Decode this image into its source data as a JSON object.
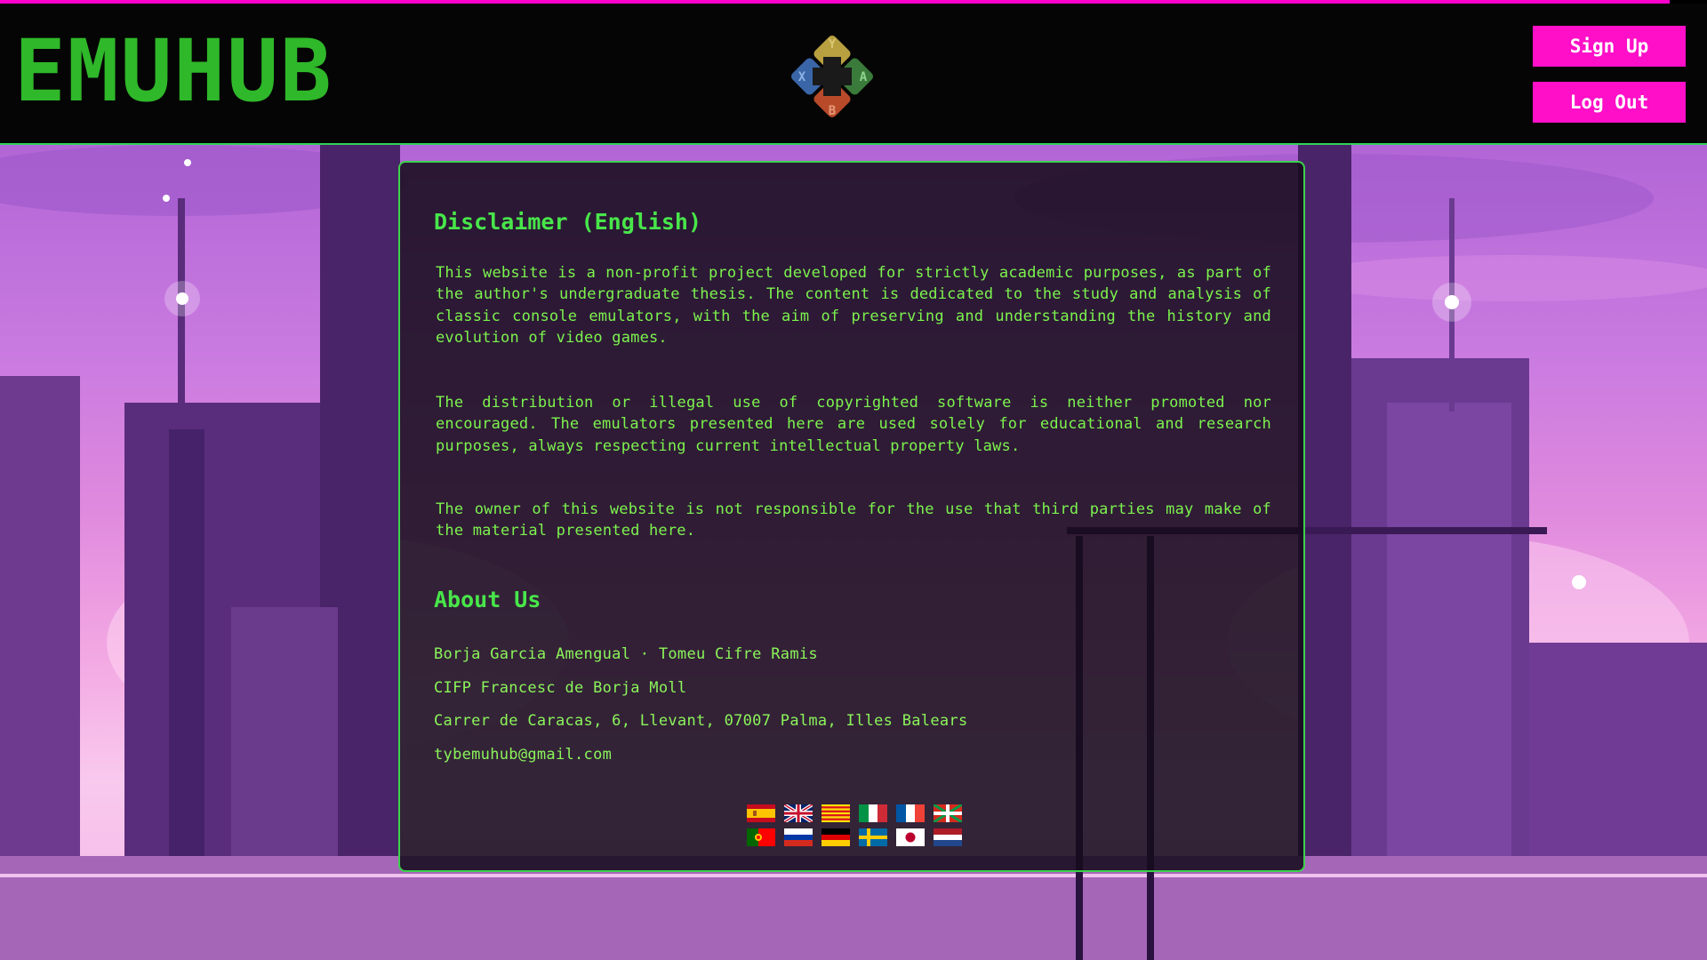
{
  "header": {
    "logo_text": "EMUHUB",
    "emblem_buttons": {
      "top": "Y",
      "left": "X",
      "right": "A",
      "bottom": "B"
    },
    "signup_label": "Sign Up",
    "logout_label": "Log Out"
  },
  "colors": {
    "accent_magenta": "#ff0fc8",
    "accent_green": "#3bd24b",
    "text_green": "#7cf34e",
    "logo_green": "#2fb82a"
  },
  "disclaimer": {
    "title": "Disclaimer (English)",
    "paragraphs": [
      "This website is a non-profit project developed for strictly academic purposes, as part of the author's undergraduate thesis. The content is dedicated to the study and analysis of classic console emulators, with the aim of preserving and understanding the history and evolution of video games.",
      "The distribution or illegal use of copyrighted software is neither promoted nor encouraged. The emulators presented here are used solely for educational and research purposes, always respecting current intellectual property laws.",
      "The owner of this website is not responsible for the use that third parties may make of the material presented here."
    ]
  },
  "about": {
    "title": "About Us",
    "authors": "Borja Garcia Amengual · Tomeu Cifre Ramis",
    "school": "CIFP Francesc de Borja Moll",
    "address": "Carrer de Caracas, 6, Llevant, 07007 Palma, Illes Balears",
    "email": "tybemuhub@gmail.com"
  },
  "languages": [
    "es-flag",
    "gb-flag",
    "catalan-flag",
    "it-flag",
    "fr-flag",
    "basque-flag",
    "pt-flag",
    "ru-flag",
    "de-flag",
    "se-flag",
    "jp-flag",
    "nl-flag"
  ]
}
